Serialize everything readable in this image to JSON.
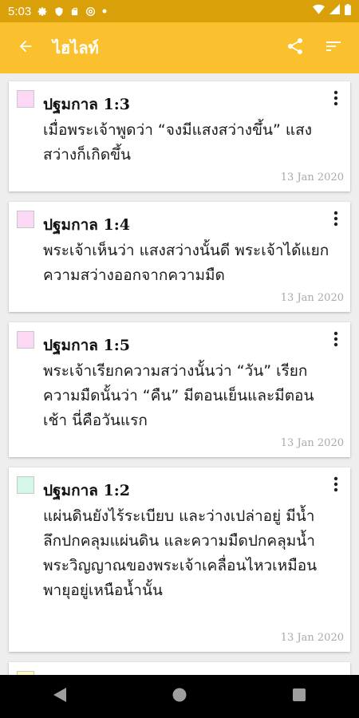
{
  "status_bar": {
    "time": "5:03",
    "icons": [
      "gear-icon",
      "shield-icon",
      "sd-card-icon",
      "at-sign-icon",
      "dot-icon"
    ],
    "right_icons": [
      "wifi-icon",
      "signal-icon",
      "battery-icon"
    ]
  },
  "app_bar": {
    "title": "ไฮไลท์",
    "actions": [
      "share-icon",
      "sort-icon"
    ]
  },
  "colors": {
    "status_bar": "#d9a00a",
    "app_bar": "#fbc02d",
    "background": "#eeeeee"
  },
  "cards": [
    {
      "title": "ปฐมกาล 1:3",
      "text": "เมื่อพระเจ้าพูดว่า “จงมีแสงสว่างขึ้น” แสงสว่างก็เกิดขึ้น",
      "date": "13 Jan 2020",
      "color": "#fbd8f4"
    },
    {
      "title": "ปฐมกาล 1:4",
      "text": "พระเจ้าเห็นว่า แสงสว่างนั้นดี พระเจ้าได้แยกความสว่างออกจากความมืด",
      "date": "13 Jan 2020",
      "color": "#fbd8f4"
    },
    {
      "title": "ปฐมกาล 1:5",
      "text": "พระเจ้าเรียกความสว่างนั้นว่า “วัน” เรียกความมืดนั้นว่า “คืน” มีตอนเย็นและมีตอนเช้า นี่คือวันแรก",
      "date": "13 Jan 2020",
      "color": "#fbd8f4"
    },
    {
      "title": "ปฐมกาล 1:2",
      "text": "แผ่นดินยังไร้ระเบียบ และว่างเปล่าอยู่ มีน้ำลึกปกคลุมแผ่นดิน และความมืดปกคลุมน้ำ พระวิญญาณของพระเจ้าเคลื่อนไหวเหมือนพายุอยู่เหนือน้ำนั้น",
      "date": "13 Jan 2020",
      "color": "#d6f7e7"
    }
  ],
  "nav_bar": [
    "back-triangle-icon",
    "home-circle-icon",
    "recents-square-icon"
  ]
}
